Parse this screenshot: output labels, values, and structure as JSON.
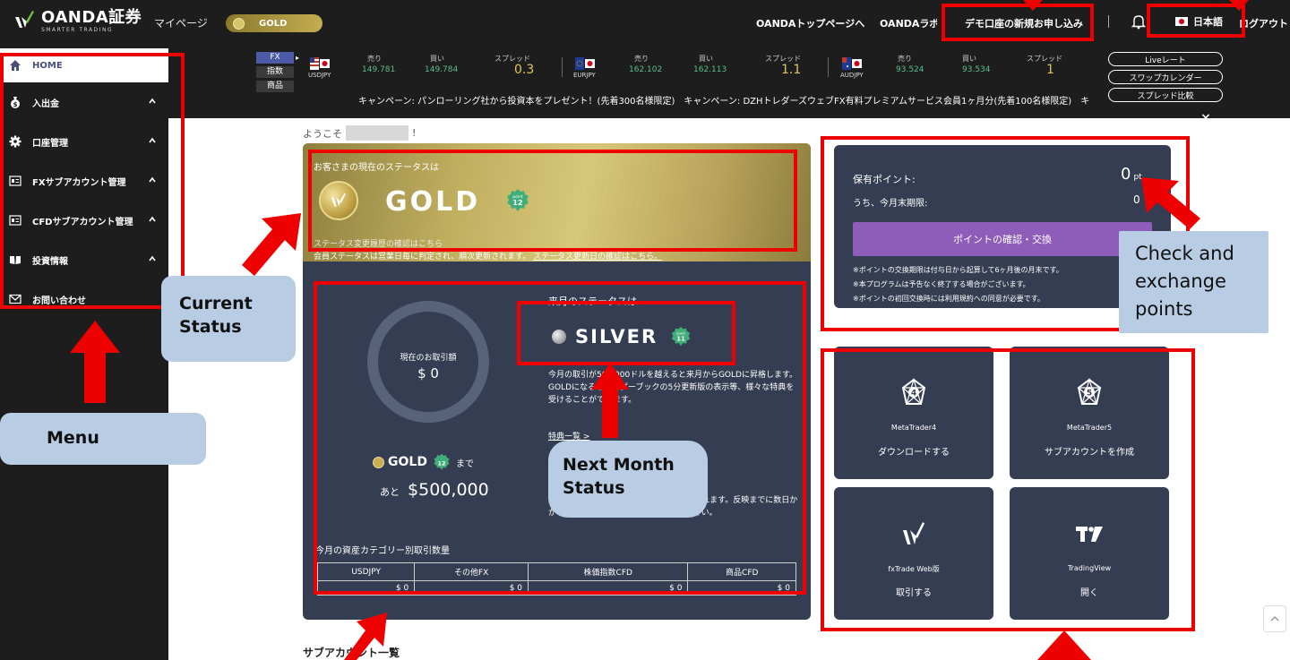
{
  "header": {
    "logo_main": "OANDA証券",
    "logo_sub": "SMARTER TRADING",
    "mypage": "マイページ",
    "status_pill": "GOLD",
    "links": [
      "OANDAトップページへ",
      "OANDAラボへ",
      "デモ口座の新規お申し込み"
    ],
    "language": "日本語",
    "logout": "ログアウト"
  },
  "sidebar": {
    "items": [
      {
        "label": "HOME"
      },
      {
        "label": "入出金"
      },
      {
        "label": "口座管理"
      },
      {
        "label": "FXサブアカウント管理"
      },
      {
        "label": "CFDサブアカウント管理"
      },
      {
        "label": "投資情報"
      },
      {
        "label": "お問い合わせ"
      }
    ]
  },
  "ticker": {
    "market_tabs": [
      "FX",
      "指数",
      "商品"
    ],
    "sell_label": "売り",
    "buy_label": "買い",
    "spread_label": "スプレッド",
    "pairs": [
      {
        "code": "USDJPY",
        "sell": "149.781",
        "buy": "149.784",
        "spread": "0.3"
      },
      {
        "code": "EURJPY",
        "sell": "162.102",
        "buy": "162.113",
        "spread": "1.1"
      },
      {
        "code": "AUDJPY",
        "sell": "93.524",
        "buy": "93.534",
        "spread": "1"
      }
    ],
    "campaign_text": "キャンペーン: パンローリング社から投資本をプレゼント！(先着300名様限定)　キャンペーン: DZHトレダーズウェブFX有料プレミアムサービス会員1ヶ月分(先着100名様限定)　キ",
    "buttons": [
      "Liveレート",
      "スワップカレンダー",
      "スプレッド比較"
    ],
    "close": "×"
  },
  "welcome": {
    "prefix": "ようこそ",
    "suffix": "!"
  },
  "status": {
    "caption": "お客さまの現在のステータスは",
    "name": "GOLD",
    "badge_points": "12",
    "history_text": "ステータス変更履歴の確認はこちら",
    "note_prefix": "会員ステータスは営業日毎に判定され、順次更新されます。",
    "note_link": "ステータス更新日の確認はこちら。",
    "ring_label": "現在のお取引額",
    "ring_value": "$ 0",
    "to_gold_name": "GOLD",
    "to_gold_suffix": "まで",
    "remain_prefix": "あと",
    "remain_value": "$500,000",
    "next_caption": "来月のステータスは",
    "next_name": "SILVER",
    "next_badge_points": "11",
    "next_desc": "今月の取引が500,000ドルを越えると来月からGOLDに昇格します。GOLDになるとオーダーブックの5分更新版の表示等、様々な特典を受けることができます。",
    "perk_link": "特典一覧 >",
    "reflect_desc": "取引額は毎営業日に集計され、順次反映されます。反映までに数日かかる場合がございますので、ご了承ください。",
    "category_title": "今月の資産カテゴリー別取引数量",
    "category_headers": [
      "USDJPY",
      "その他FX",
      "株価指数CFD",
      "商品CFD"
    ],
    "category_values": [
      "$ 0",
      "$ 0",
      "$ 0",
      "$ 0"
    ]
  },
  "points": {
    "label": "保有ポイント:",
    "value": "0",
    "unit": "pt",
    "expiring_label": "うち、今月末期限:",
    "expiring_value": "0",
    "button": "ポイントの確認・交換",
    "notes": [
      "※ポイントの交換期限は付与日から起算して6ヶ月後の月末です。",
      "※本プログラムは予告なく終了する場合がございます。",
      "※ポイントの初回交換時には利用規約への同意が必要です。"
    ]
  },
  "tiles": [
    {
      "name": "MetaTrader4",
      "action": "ダウンロードする",
      "icon_num": "4"
    },
    {
      "name": "MetaTrader5",
      "action": "サブアカウントを作成",
      "icon_num": "5"
    },
    {
      "name": "fxTrade Web版",
      "action": "取引する"
    },
    {
      "name": "TradingView",
      "action": "開く"
    }
  ],
  "subaccount_title": "サブアカウント一覧",
  "annotations": {
    "current_status": "Current Status",
    "menu": "Menu",
    "next_month_status": "Next Month Status",
    "check_points": "Check and exchange points"
  },
  "colors": {
    "header_bg": "#1d1d1d",
    "card_bg": "#353d52",
    "accent_purple": "#8e5cb9",
    "annotation_red": "#ef0000",
    "callout_blue": "#b8cce4"
  }
}
